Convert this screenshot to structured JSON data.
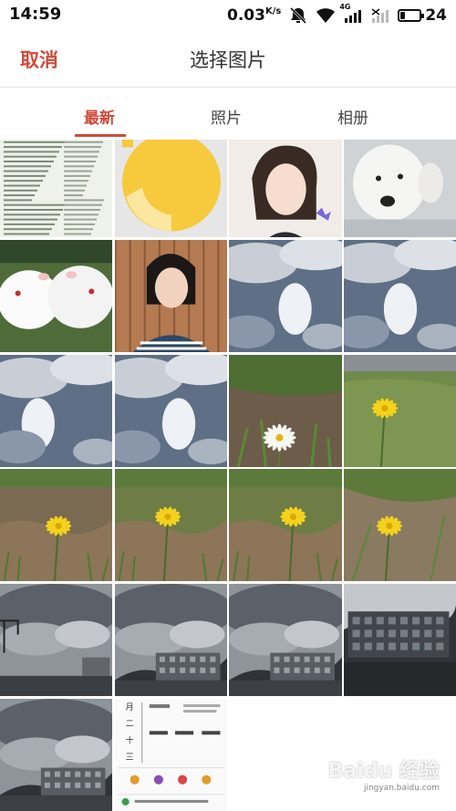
{
  "status_bar": {
    "time": "14:59",
    "speed": "0.03",
    "speed_unit": "K/s",
    "network": "4G",
    "battery": "24",
    "battery_fraction": 0.24
  },
  "header": {
    "cancel_label": "取消",
    "title": "选择图片"
  },
  "tabs": [
    {
      "label": "最新",
      "active": true
    },
    {
      "label": "照片",
      "active": false
    },
    {
      "label": "相册",
      "active": false
    }
  ],
  "photos": [
    {
      "name": "photo-document-screenshot"
    },
    {
      "name": "photo-yellow-circle-avatar"
    },
    {
      "name": "photo-illustrated-girl"
    },
    {
      "name": "photo-white-dog"
    },
    {
      "name": "photo-white-hamsters"
    },
    {
      "name": "photo-girl-portrait"
    },
    {
      "name": "photo-cloudy-sky-1"
    },
    {
      "name": "photo-cloudy-sky-2"
    },
    {
      "name": "photo-cloudy-sky-3"
    },
    {
      "name": "photo-cloudy-sky-4"
    },
    {
      "name": "photo-white-flower"
    },
    {
      "name": "photo-yellow-flower-1"
    },
    {
      "name": "photo-yellow-flower-2"
    },
    {
      "name": "photo-yellow-flower-3"
    },
    {
      "name": "photo-yellow-flower-4"
    },
    {
      "name": "photo-yellow-flower-5"
    },
    {
      "name": "photo-storm-clouds-1"
    },
    {
      "name": "photo-storm-clouds-2"
    },
    {
      "name": "photo-storm-clouds-3"
    },
    {
      "name": "photo-campus-building"
    },
    {
      "name": "photo-storm-clouds-4"
    },
    {
      "name": "photo-calendar-card"
    }
  ],
  "watermark": {
    "text": "Baidu 经验",
    "sub": "jingyan.baidu.com"
  }
}
